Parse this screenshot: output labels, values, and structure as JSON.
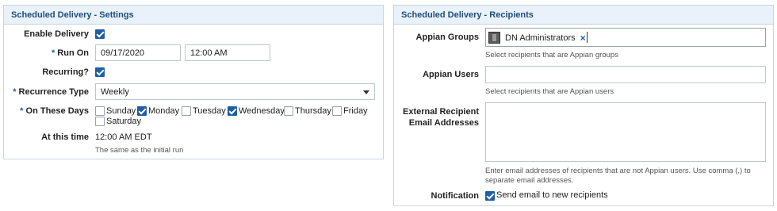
{
  "settings": {
    "title": "Scheduled Delivery - Settings",
    "enable_delivery_label": "Enable Delivery",
    "enable_delivery_checked": true,
    "run_on_label": "Run On",
    "run_on_date": "09/17/2020",
    "run_on_time": "12:00 AM",
    "recurring_label": "Recurring?",
    "recurring_checked": true,
    "recurrence_type_label": "Recurrence Type",
    "recurrence_type_value": "Weekly",
    "on_these_days_label": "On These Days",
    "days": [
      {
        "label": "Sunday",
        "checked": false
      },
      {
        "label": "Monday",
        "checked": true
      },
      {
        "label": "Tuesday",
        "checked": false
      },
      {
        "label": "Wednesday",
        "checked": true
      },
      {
        "label": "Thursday",
        "checked": false
      },
      {
        "label": "Friday",
        "checked": false
      },
      {
        "label": "Saturday",
        "checked": false
      }
    ],
    "at_this_time_label": "At this time",
    "at_this_time_value": "12:00 AM EDT",
    "at_this_time_hint": "The same as the initial run"
  },
  "recipients": {
    "title": "Scheduled Delivery - Recipients",
    "appian_groups_label": "Appian Groups",
    "group_chip": "DN Administrators",
    "appian_groups_hint": "Select recipients that are Appian groups",
    "appian_users_label": "Appian Users",
    "appian_users_hint": "Select recipients that are Appian users",
    "external_label_line1": "External Recipient",
    "external_label_line2": "Email Addresses",
    "external_hint_line1": "Enter email addresses of recipients that are not Appian users. Use comma (,) to",
    "external_hint_line2": "separate email addresses.",
    "notification_label": "Notification",
    "notification_checked": true,
    "notification_text": "Send email to new recipients"
  },
  "required_marker": "*"
}
